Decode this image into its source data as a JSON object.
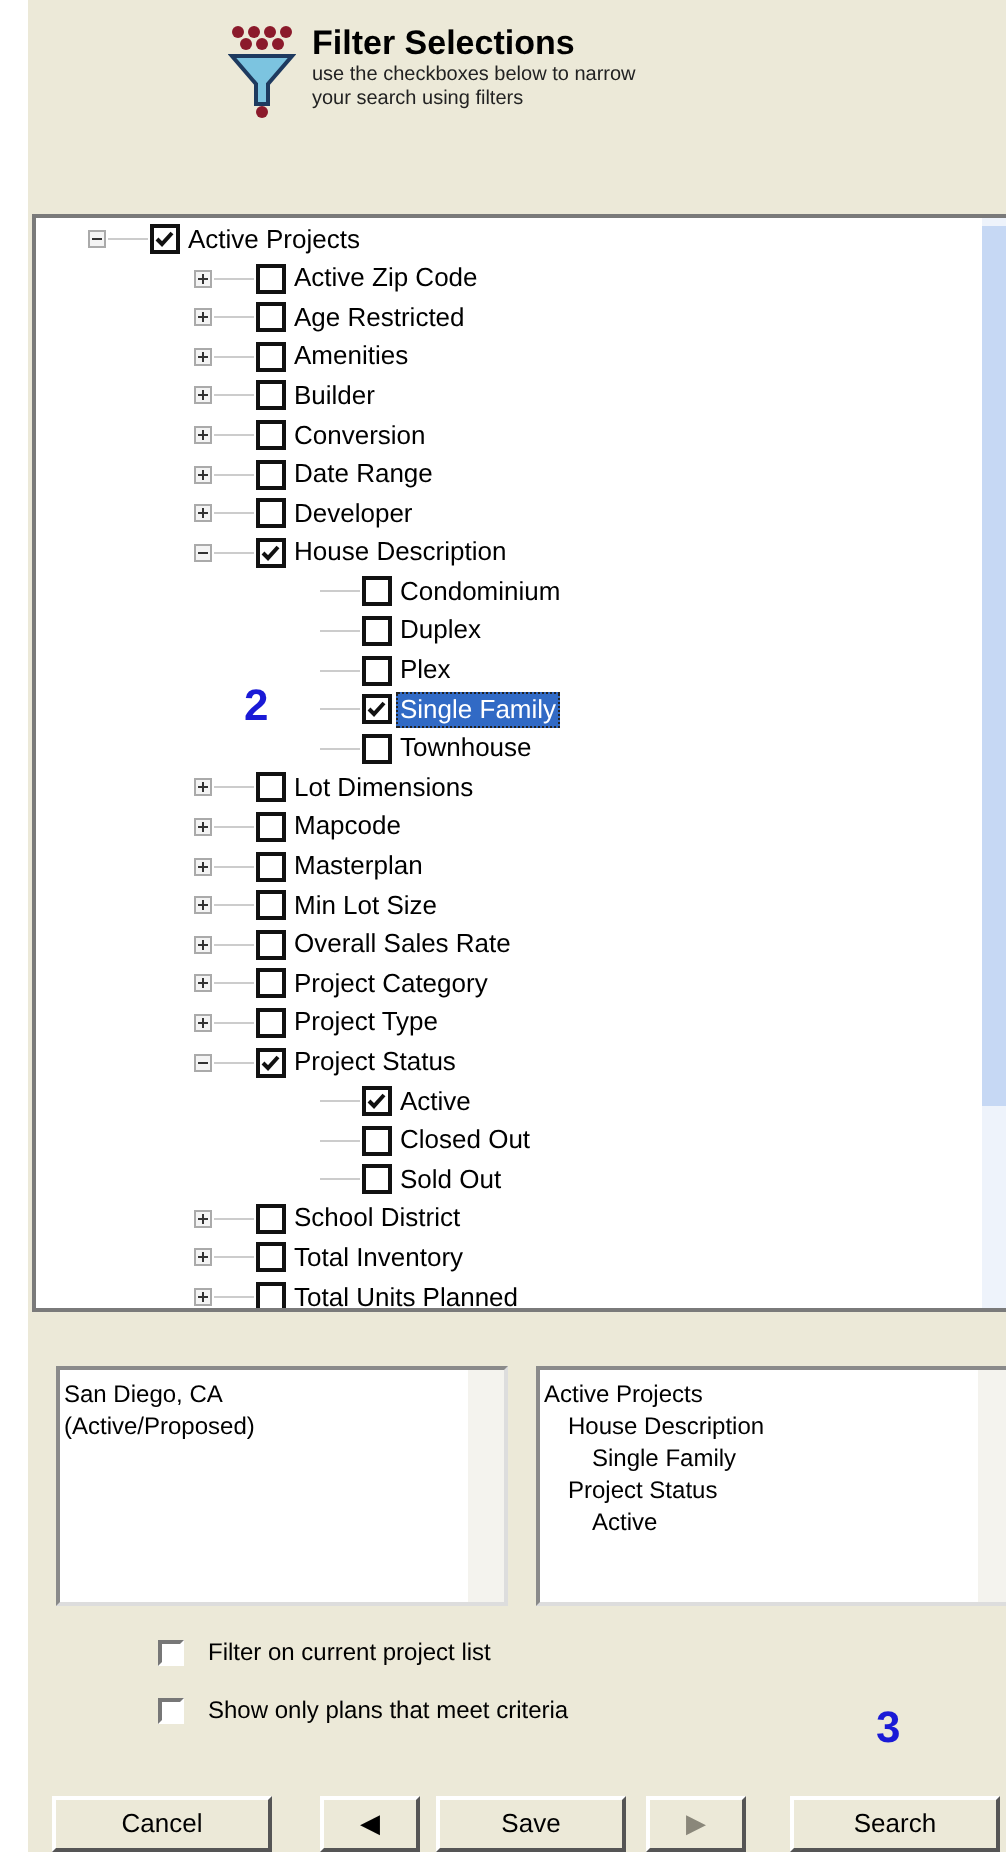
{
  "header": {
    "title": "Filter Selections",
    "subtitle": "use the checkboxes below to narrow your search using filters"
  },
  "tree": [
    {
      "label": "Active Projects",
      "checked": true,
      "expanded": true,
      "selected": false,
      "children": [
        {
          "label": "Active Zip Code",
          "checked": false,
          "expanded": false,
          "selected": false
        },
        {
          "label": "Age Restricted",
          "checked": false,
          "expanded": false,
          "selected": false
        },
        {
          "label": "Amenities",
          "checked": false,
          "expanded": false,
          "selected": false
        },
        {
          "label": "Builder",
          "checked": false,
          "expanded": false,
          "selected": false
        },
        {
          "label": "Conversion",
          "checked": false,
          "expanded": false,
          "selected": false
        },
        {
          "label": "Date Range",
          "checked": false,
          "expanded": false,
          "selected": false
        },
        {
          "label": "Developer",
          "checked": false,
          "expanded": false,
          "selected": false
        },
        {
          "label": "House Description",
          "checked": true,
          "expanded": true,
          "selected": false,
          "children": [
            {
              "label": "Condominium",
              "checked": false,
              "selected": false
            },
            {
              "label": "Duplex",
              "checked": false,
              "selected": false
            },
            {
              "label": "Plex",
              "checked": false,
              "selected": false
            },
            {
              "label": "Single Family",
              "checked": true,
              "selected": true,
              "annotation": "2"
            },
            {
              "label": "Townhouse",
              "checked": false,
              "selected": false
            }
          ]
        },
        {
          "label": "Lot Dimensions",
          "checked": false,
          "expanded": false,
          "selected": false
        },
        {
          "label": "Mapcode",
          "checked": false,
          "expanded": false,
          "selected": false
        },
        {
          "label": "Masterplan",
          "checked": false,
          "expanded": false,
          "selected": false
        },
        {
          "label": "Min Lot Size",
          "checked": false,
          "expanded": false,
          "selected": false
        },
        {
          "label": "Overall Sales Rate",
          "checked": false,
          "expanded": false,
          "selected": false
        },
        {
          "label": "Project Category",
          "checked": false,
          "expanded": false,
          "selected": false
        },
        {
          "label": "Project Type",
          "checked": false,
          "expanded": false,
          "selected": false
        },
        {
          "label": "Project Status",
          "checked": true,
          "expanded": true,
          "selected": false,
          "children": [
            {
              "label": "Active",
              "checked": true,
              "selected": false
            },
            {
              "label": "Closed Out",
              "checked": false,
              "selected": false
            },
            {
              "label": "Sold Out",
              "checked": false,
              "selected": false
            }
          ]
        },
        {
          "label": "School District",
          "checked": false,
          "expanded": false,
          "selected": false
        },
        {
          "label": "Total Inventory",
          "checked": false,
          "expanded": false,
          "selected": false
        },
        {
          "label": "Total Units Planned",
          "checked": false,
          "expanded": false,
          "selected": false
        }
      ]
    }
  ],
  "location_box": {
    "lines": [
      "San Diego, CA",
      "(Active/Proposed)"
    ]
  },
  "summary_box": {
    "lines": [
      {
        "text": "Active Projects",
        "children": [
          {
            "text": "House Description",
            "children": [
              {
                "text": "Single Family"
              }
            ]
          },
          {
            "text": "Project Status",
            "children": [
              {
                "text": "Active"
              }
            ]
          }
        ]
      }
    ]
  },
  "options": [
    {
      "label": "Filter on current project list",
      "checked": false
    },
    {
      "label": "Show only plans that meet criteria",
      "checked": false
    }
  ],
  "search_annotation": "3",
  "buttons": [
    {
      "kind": "text",
      "label": "Cancel",
      "disabled": false
    },
    {
      "kind": "prev",
      "label": "◀",
      "disabled": false
    },
    {
      "kind": "text",
      "label": "Save",
      "disabled": false
    },
    {
      "kind": "next",
      "label": "▶",
      "disabled": true
    },
    {
      "kind": "text",
      "label": "Search",
      "disabled": false
    }
  ]
}
